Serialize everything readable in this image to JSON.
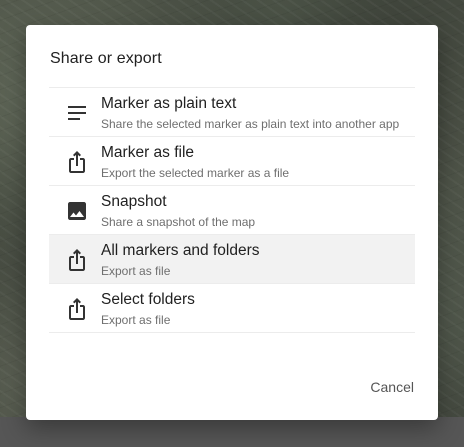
{
  "dialog": {
    "title": "Share or export",
    "cancel_label": "Cancel"
  },
  "options": [
    {
      "icon": "notes-icon",
      "label": "Marker as plain text",
      "description": "Share the selected marker as plain text into another app"
    },
    {
      "icon": "share-icon",
      "label": "Marker as file",
      "description": "Export the selected marker as a file"
    },
    {
      "icon": "image-icon",
      "label": "Snapshot",
      "description": "Share a snapshot of the map"
    },
    {
      "icon": "share-icon",
      "label": "All markers and folders",
      "description": "Export as file",
      "highlighted": true
    },
    {
      "icon": "share-icon",
      "label": "Select folders",
      "description": "Export as file"
    }
  ],
  "colors": {
    "icon": "#333333",
    "text_primary": "#212121",
    "text_secondary": "#6f6f6f",
    "highlight": "#f2f2f2"
  }
}
